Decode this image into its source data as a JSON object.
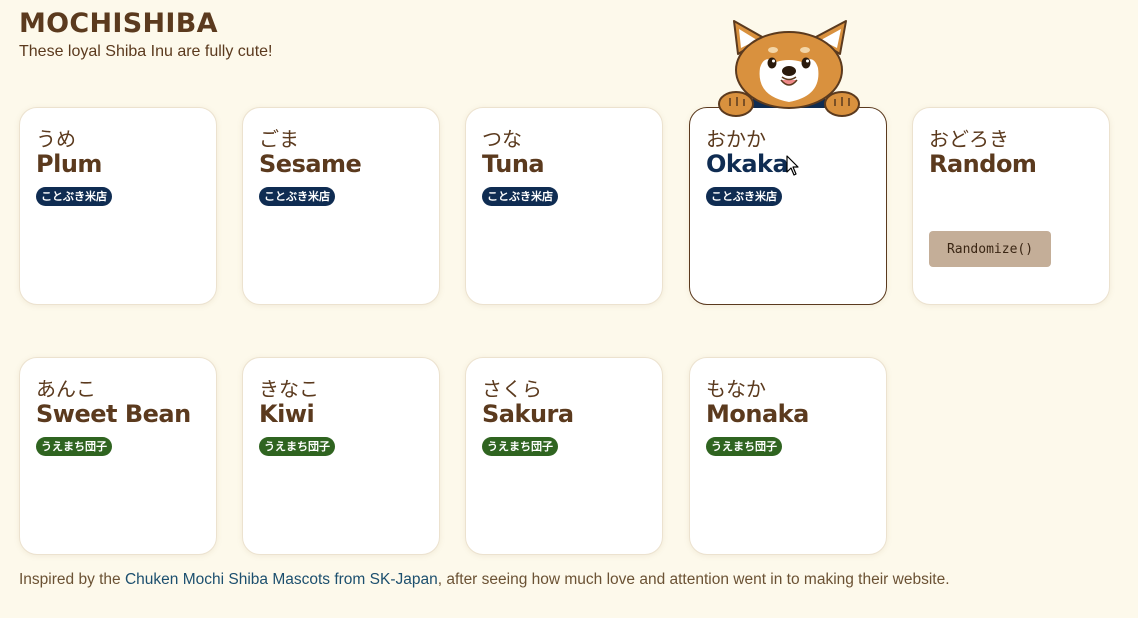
{
  "header": {
    "title": "MOCHISHIBA",
    "tagline": "These loyal Shiba Inu are fully cute!"
  },
  "cards": [
    {
      "jp": "うめ",
      "en": "Plum",
      "badge": "ことぶき米店",
      "badge_color": "#0f2c52"
    },
    {
      "jp": "ごま",
      "en": "Sesame",
      "badge": "ことぶき米店",
      "badge_color": "#0f2c52"
    },
    {
      "jp": "つな",
      "en": "Tuna",
      "badge": "ことぶき米店",
      "badge_color": "#0f2c52"
    },
    {
      "jp": "おかか",
      "en": "Okaka",
      "badge": "ことぶき米店",
      "badge_color": "#0f2c52",
      "hovered": true
    },
    {
      "jp": "おどろき",
      "en": "Random",
      "button": "Randomize()"
    },
    {
      "jp": "あんこ",
      "en": "Sweet Bean",
      "badge": "うえまち団子",
      "badge_color": "#2f6420"
    },
    {
      "jp": "きなこ",
      "en": "Kiwi",
      "badge": "うえまち団子",
      "badge_color": "#2f6420"
    },
    {
      "jp": "さくら",
      "en": "Sakura",
      "badge": "うえまち団子",
      "badge_color": "#2f6420"
    },
    {
      "jp": "もなか",
      "en": "Monaka",
      "badge": "うえまち団子",
      "badge_color": "#2f6420"
    }
  ],
  "footer": {
    "prefix": "Inspired by the ",
    "link": "Chuken Mochi Shiba Mascots from SK-Japan",
    "suffix": ", after seeing how much love and attention went in to making their website."
  },
  "colors": {
    "background": "#fdf9eb",
    "brown": "#5b3a1e",
    "navy": "#0f2c52",
    "green": "#2f6420",
    "button": "#c4ae98",
    "link": "#1c4f6e"
  },
  "icons": {
    "mascot": "shiba-mascot-icon",
    "cursor": "mouse-pointer-icon"
  }
}
